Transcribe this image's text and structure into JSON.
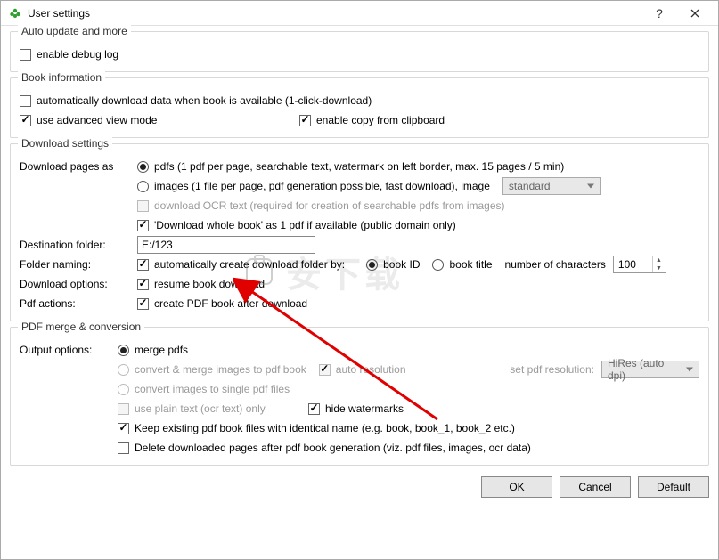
{
  "window": {
    "title": "User settings"
  },
  "group_auto": {
    "title": "Auto update and more",
    "enable_debug": "enable debug log"
  },
  "group_book": {
    "title": "Book information",
    "auto_download": "automatically download data when book is available (1-click-download)",
    "advanced_view": "use advanced view mode",
    "copy_clipboard": "enable copy from clipboard"
  },
  "group_download": {
    "title": "Download settings",
    "download_pages_as": "Download pages as",
    "pdfs": "pdfs (1 pdf per page, searchable text,  watermark on left border,  max. 15 pages / 5 min)",
    "images": "images (1 file per page, pdf generation possible, fast download), image",
    "image_quality": "standard",
    "download_ocr": "download OCR text (required for creation of searchable pdfs from images)",
    "whole_book": "'Download whole book' as 1 pdf if available (public domain only)",
    "dest_folder_label": "Destination folder:",
    "dest_folder_value": "E:/123",
    "folder_naming_label": "Folder naming:",
    "auto_create_folder": "automatically create download folder by:",
    "book_id": "book ID",
    "book_title": "book title",
    "num_chars": "number of characters",
    "num_chars_value": "100",
    "dl_options_label": "Download options:",
    "resume": "resume book download",
    "pdf_actions_label": "Pdf actions:",
    "create_pdf": "create PDF book after download"
  },
  "group_merge": {
    "title": "PDF merge & conversion",
    "output_options": "Output options:",
    "merge_pdfs": "merge pdfs",
    "convert_merge": "convert & merge images to pdf book",
    "auto_resolution": "auto resolution",
    "set_pdf_res": "set pdf resolution:",
    "res_value": "HiRes (auto dpi)",
    "convert_single": "convert images to single pdf files",
    "use_plain": "use plain text (ocr text) only",
    "hide_watermarks": "hide watermarks",
    "keep_existing": "Keep existing pdf book files with identical name (e.g. book, book_1, book_2 etc.)",
    "delete_downloaded": "Delete downloaded pages after pdf book generation (viz. pdf files, images, ocr data)"
  },
  "buttons": {
    "ok": "OK",
    "cancel": "Cancel",
    "default": "Default"
  },
  "watermark_text": "安下载"
}
